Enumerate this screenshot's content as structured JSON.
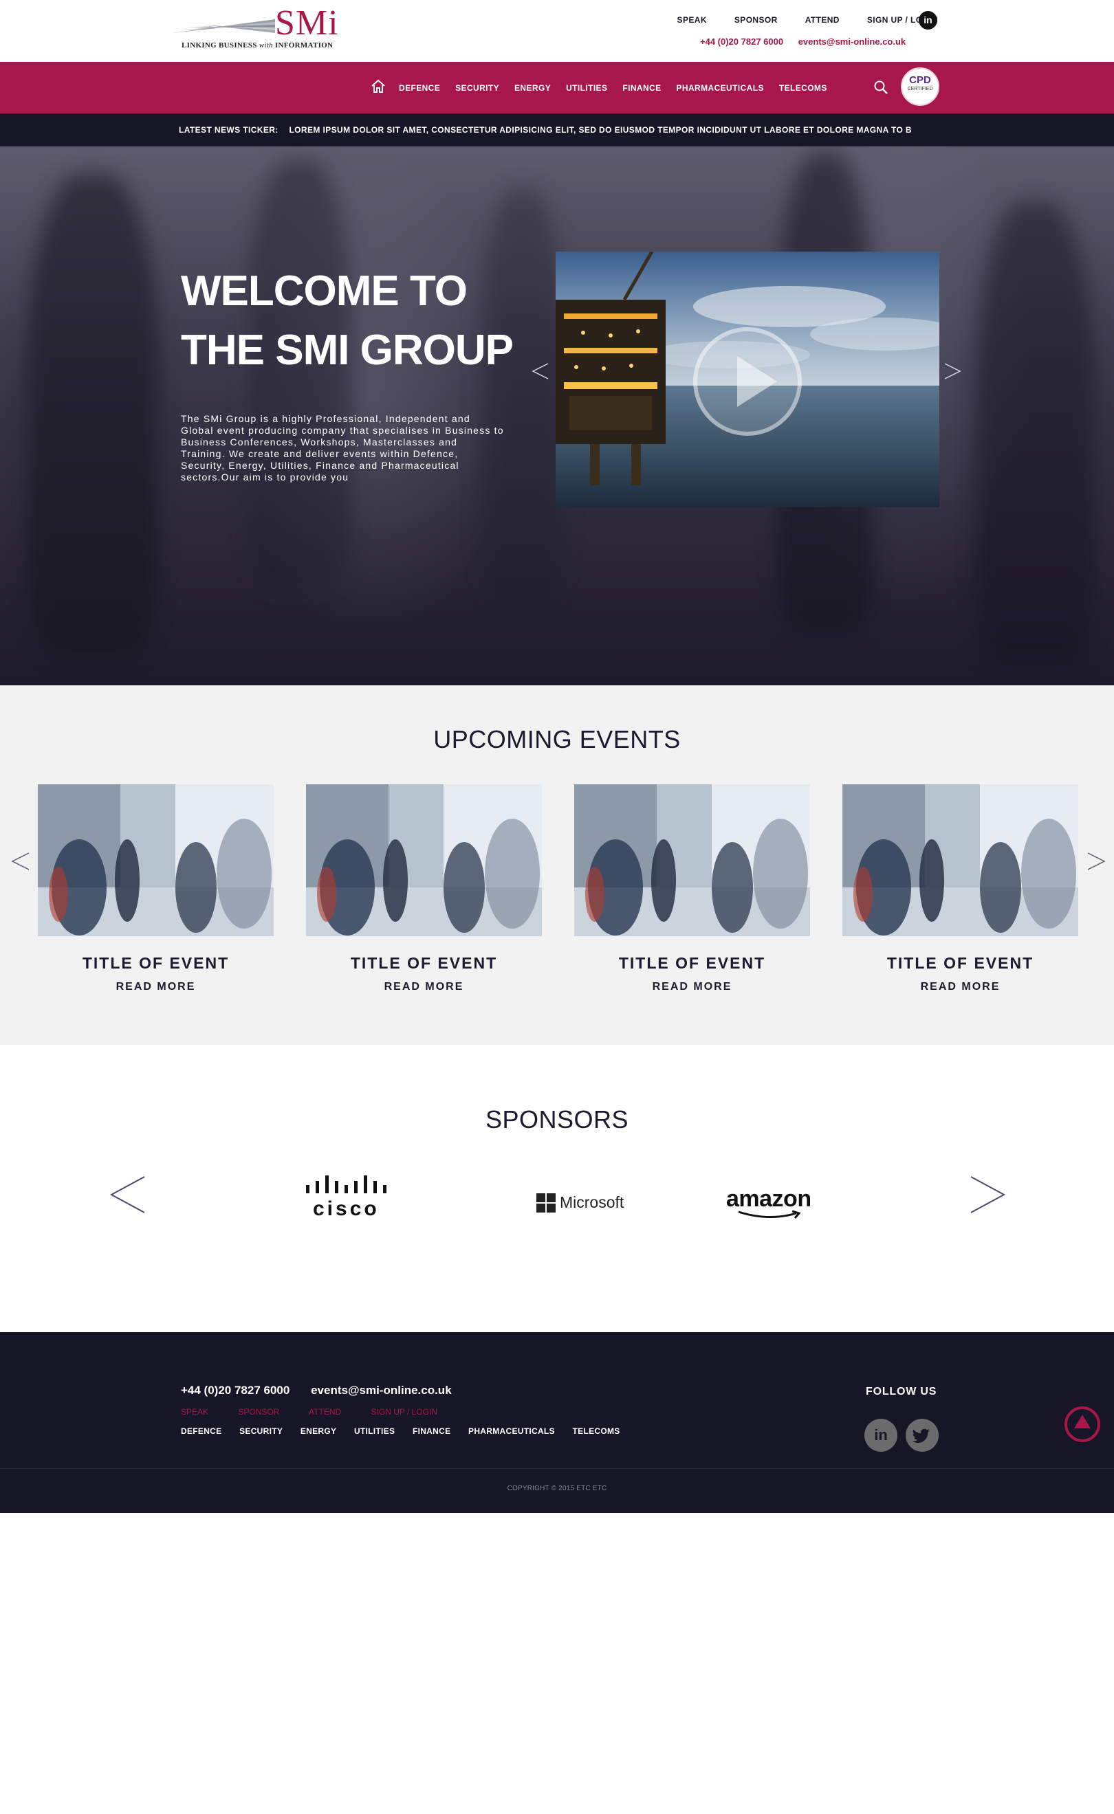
{
  "header": {
    "logo_text": "SMi",
    "logo_tagline_1": "LINKING BUSINESS ",
    "logo_tagline_2": "with",
    "logo_tagline_3": " INFORMATION",
    "top_links": [
      "SPEAK",
      "SPONSOR",
      "ATTEND",
      "SIGN UP / LOGIN"
    ],
    "linkedin_label": "in",
    "phone": "+44 (0)20 7827 6000",
    "email": "events@smi-online.co.uk"
  },
  "nav": {
    "items": [
      "DEFENCE",
      "SECURITY",
      "ENERGY",
      "UTILITIES",
      "FINANCE",
      "PHARMACEUTICALS",
      "TELECOMS"
    ],
    "badge_title": "CPD",
    "badge_sub": "CERTIFIED"
  },
  "ticker": {
    "label": "LATEST NEWS TICKER:",
    "text": "LOREM IPSUM DOLOR SIT AMET, CONSECTETUR ADIPISICING ELIT, SED DO EIUSMOD TEMPOR INCIDIDUNT UT LABORE ET DOLORE MAGNA  TO B"
  },
  "hero": {
    "title_line1": "WELCOME TO",
    "title_line2": "THE SMI GROUP",
    "body": "The SMi Group is a highly Professional, Independent and Global event producing company that specialises in Business to Business Conferences, Workshops, Masterclasses and Training. We create and deliver events within Defence, Security, Energy, Utilities, Finance and Pharmaceutical sectors.Our aim is to provide you"
  },
  "events": {
    "title": "UPCOMING EVENTS",
    "cards": [
      {
        "title": "TITLE OF EVENT",
        "more": "READ MORE"
      },
      {
        "title": "TITLE OF EVENT",
        "more": "READ MORE"
      },
      {
        "title": "TITLE OF EVENT",
        "more": "READ MORE"
      },
      {
        "title": "TITLE OF EVENT",
        "more": "READ MORE"
      }
    ]
  },
  "sponsors": {
    "title": "SPONSORS",
    "logos": [
      "cisco",
      "Microsoft",
      "amazon"
    ]
  },
  "footer": {
    "phone": "+44 (0)20 7827 6000",
    "email": "events@smi-online.co.uk",
    "top_links": [
      "SPEAK",
      "SPONSOR",
      "ATTEND",
      "SIGN UP / LOGIN"
    ],
    "nav": [
      "DEFENCE",
      "SECURITY",
      "ENERGY",
      "UTILITIES",
      "FINANCE",
      "PHARMACEUTICALS",
      "TELECOMS"
    ],
    "follow": "FOLLOW US",
    "linkedin_label": "in",
    "copyright": "COPYRIGHT © 2015 ETC ETC"
  },
  "colors": {
    "brand": "#a8174a",
    "dark": "#171626",
    "light_bg": "#f2f2f2"
  },
  "icons": [
    "home-icon",
    "search-icon",
    "linkedin-icon",
    "twitter-icon",
    "play-icon",
    "chevron-left-icon",
    "chevron-right-icon",
    "back-to-top-icon"
  ]
}
